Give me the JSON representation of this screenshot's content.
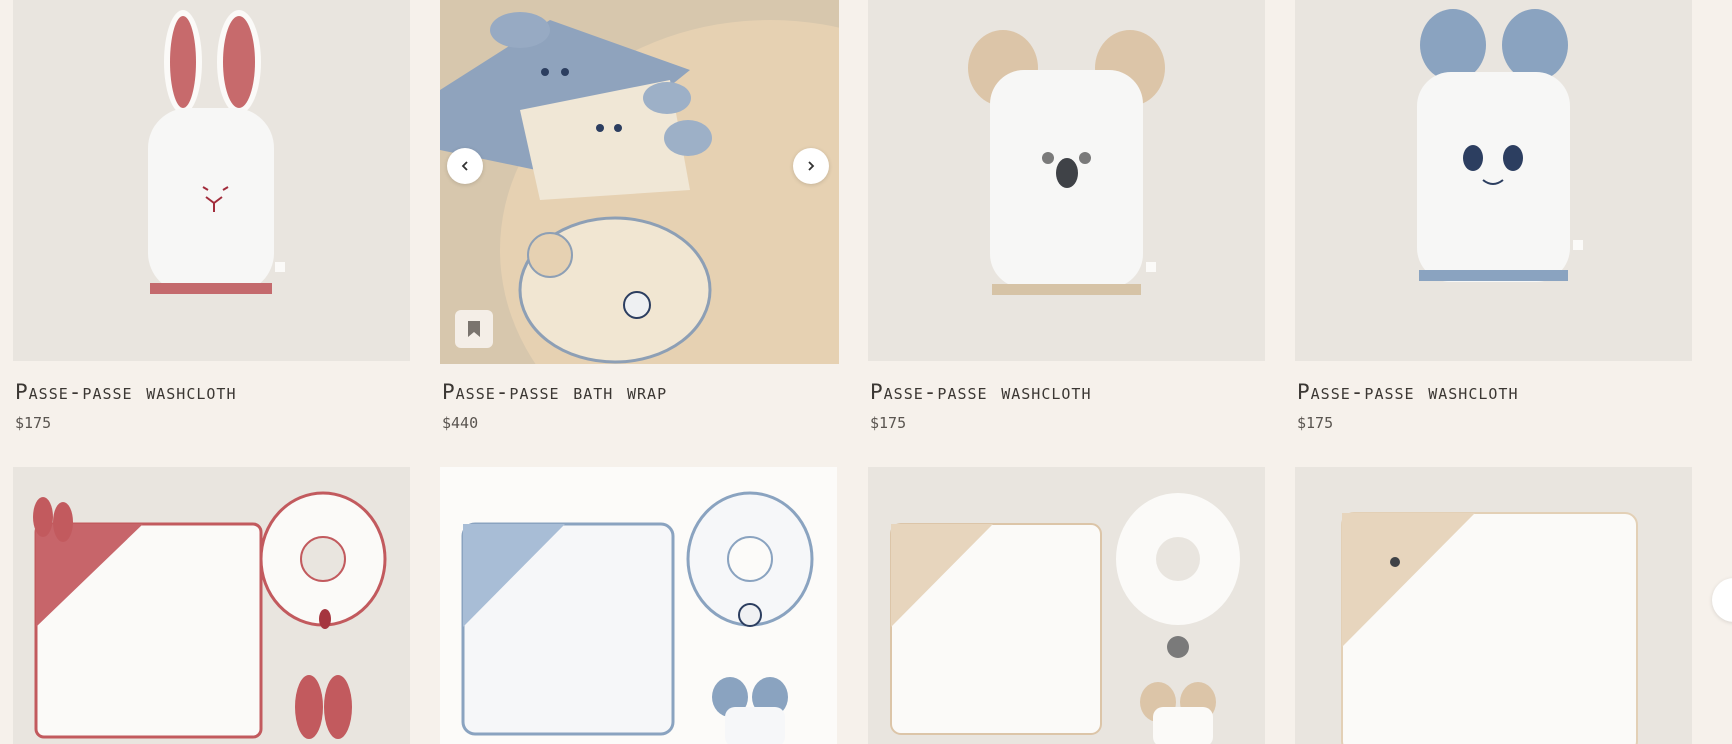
{
  "products": [
    {
      "title": "Passe-passe washcloth",
      "price": "$175",
      "image": "bunny-washcloth-red"
    },
    {
      "title": "Passe-passe bath wrap",
      "price": "$440",
      "image": "panda-bath-wrap-set"
    },
    {
      "title": "Passe-passe washcloth",
      "price": "$175",
      "image": "koala-washcloth-beige"
    },
    {
      "title": "Passe-passe washcloth",
      "price": "$175",
      "image": "panda-washcloth-blue"
    },
    {
      "image": "bunny-gift-set-red"
    },
    {
      "image": "panda-gift-set-blue"
    },
    {
      "image": "koala-gift-set-beige"
    },
    {
      "image": "koala-hooded-towel-beige"
    }
  ],
  "carousel": {
    "prev_icon": "chevron-left-icon",
    "next_icon": "chevron-right-icon"
  },
  "colors": {
    "page_bg": "#f6f1eb",
    "photo_bg": "#e9e5df",
    "red_stripe": "#c25a5e",
    "blue_stripe": "#8aa3c0",
    "beige_stripe": "#dcc5a8",
    "navy_embroidery": "#2c3e60"
  }
}
